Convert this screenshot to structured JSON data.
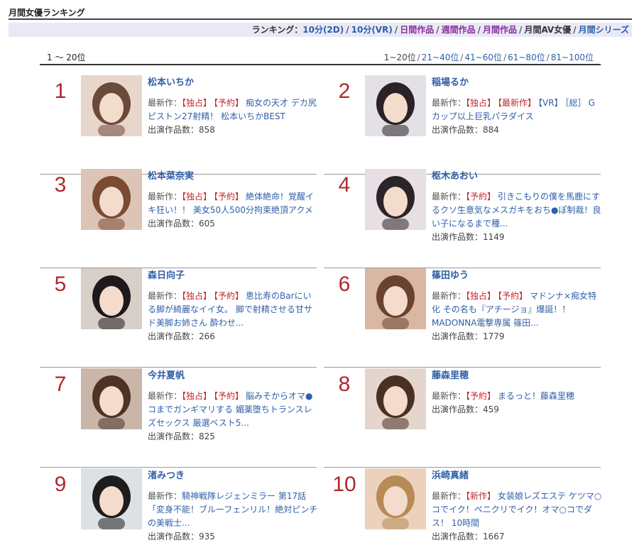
{
  "page_title": "月間女優ランキング",
  "nav": {
    "label": "ランキング：",
    "links": [
      {
        "text": "10分(2D)",
        "color": "#2f5fa8"
      },
      {
        "text": "10分(VR)",
        "color": "#2f5fa8"
      },
      {
        "text": "日間作品",
        "color": "#8a2e9e"
      },
      {
        "text": "週間作品",
        "color": "#8a2e9e"
      },
      {
        "text": "月間作品",
        "color": "#8a2e9e"
      },
      {
        "text": "月間AV女優",
        "color": "#333333"
      },
      {
        "text": "月間シリーズ",
        "color": "#2f5fa8"
      }
    ],
    "separator": "/"
  },
  "range": {
    "current": "1 ～ 20位",
    "links": [
      "1~20位",
      "21~40位",
      "41~60位",
      "61~80位",
      "81~100位"
    ]
  },
  "latest_prefix": "最新作：",
  "count_prefix": "出演作品数：",
  "actresses": [
    {
      "rank": "1",
      "name": "松本いちか",
      "tags": [
        "【独占】",
        "【予約】"
      ],
      "title": "痴女の天才 デカ尻ピストン27射精！ 松本いちかBEST",
      "count": "858"
    },
    {
      "rank": "2",
      "name": "稲場るか",
      "tags": [
        "【独占】",
        "【最新作】",
        "【VR】",
        "［総］"
      ],
      "title": "Gカップ以上巨乳パラダイス",
      "count": "884"
    },
    {
      "rank": "3",
      "name": "松本菜奈実",
      "tags": [
        "【独占】",
        "【予約】"
      ],
      "title": "絶体絶命！覚醒イキ狂い！！ 美女50人500分拘束絶頂アクメ",
      "count": "605"
    },
    {
      "rank": "4",
      "name": "枢木あおい",
      "tags": [
        "【予約】"
      ],
      "title": "引きこもりの僕を馬鹿にするクソ生意気なメスガキをおち●ぽ制裁！良い子になるまで種...",
      "count": "1149"
    },
    {
      "rank": "5",
      "name": "森日向子",
      "tags": [
        "【独占】",
        "【予約】"
      ],
      "title": "恵比寿のBarにいる脚が綺麗なイイ女。 脚で射精させる甘サド美脚お姉さん 酔わせ...",
      "count": "266"
    },
    {
      "rank": "6",
      "name": "篠田ゆう",
      "tags": [
        "【独占】",
        "【予約】"
      ],
      "title": "マドンナ×痴女特化 その名も『アチージョ』爆誕！！ MADONNA電撃専属 篠田...",
      "count": "1779"
    },
    {
      "rank": "7",
      "name": "今井夏帆",
      "tags": [
        "【独占】",
        "【予約】"
      ],
      "title": "脳みそからオマ●コまでガンギマリする 媚薬堕ちトランスレズセックス 厳選ベスト5...",
      "count": "825"
    },
    {
      "rank": "8",
      "name": "藤森里穂",
      "tags": [
        "【予約】"
      ],
      "title": "まるっと！藤森里穂",
      "count": "459"
    },
    {
      "rank": "9",
      "name": "渚みつき",
      "tags": [],
      "title": "騎神戦隊レジェンミラー 第17話「変身不能！ブルーフェンリル！絶対ピンチの美戦士...",
      "count": "935"
    },
    {
      "rank": "10",
      "name": "浜崎真緒",
      "tags": [
        "【新作】"
      ],
      "title": "女装娘レズエステ ケツマ○コでイク！ペニクリでイク！オマ○コでダス！ 10時間",
      "count": "1667"
    }
  ],
  "colors": {
    "rank": "#b0282d",
    "link": "#2f5fa8",
    "tag": "#c0272d",
    "nav_bg": "#e9e9f6"
  }
}
